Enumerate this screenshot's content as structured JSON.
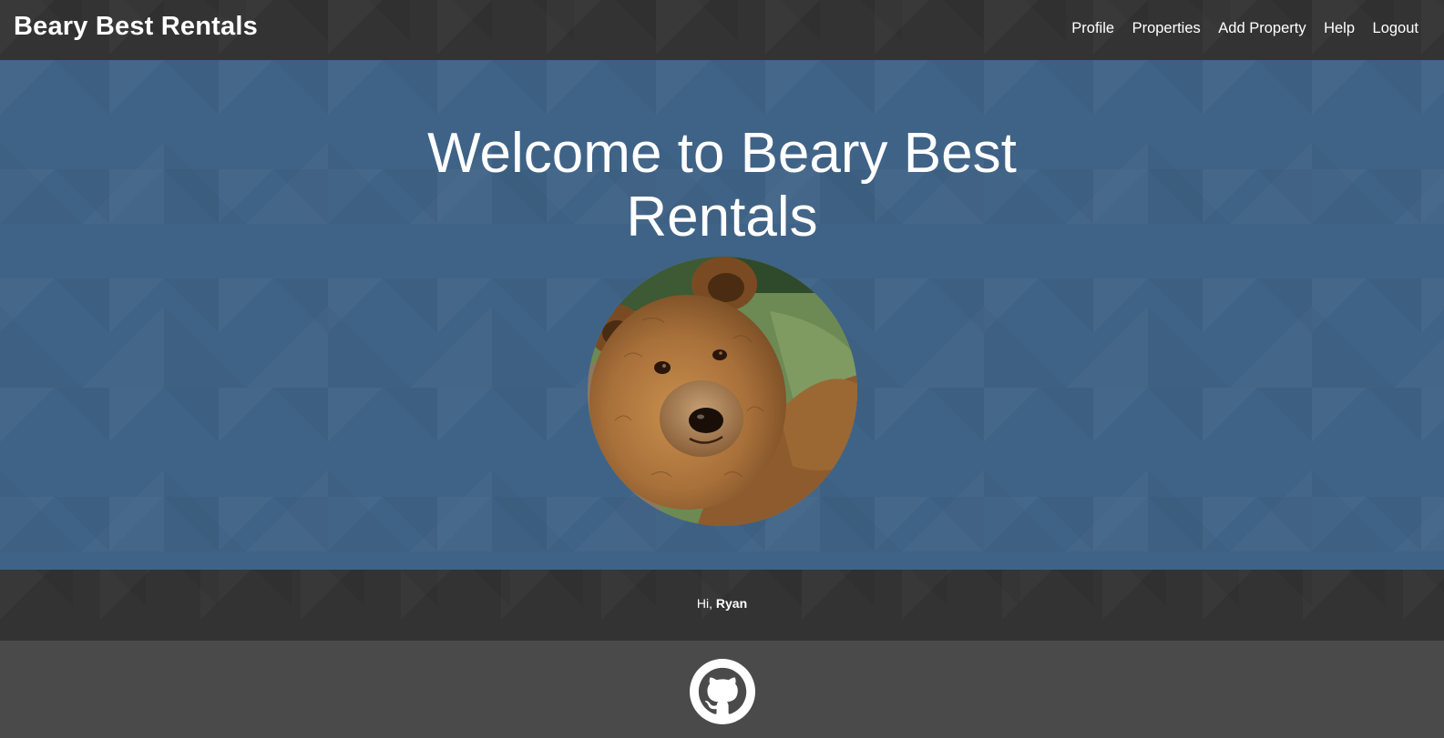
{
  "navbar": {
    "brand": "Beary Best Rentals",
    "links": [
      "Profile",
      "Properties",
      "Add Property",
      "Help",
      "Logout"
    ]
  },
  "hero": {
    "title_line1": "Welcome to Beary Best",
    "title_line2": "Rentals",
    "image": "bear-photo"
  },
  "greeting": {
    "prefix": "Hi,",
    "username": "Ryan"
  },
  "footer": {
    "icon": "github-icon"
  },
  "colors": {
    "navbar_bg": "#333333",
    "hero_bg": "#3f6387",
    "footer_bg": "#4a4a4a",
    "text": "#ffffff"
  }
}
